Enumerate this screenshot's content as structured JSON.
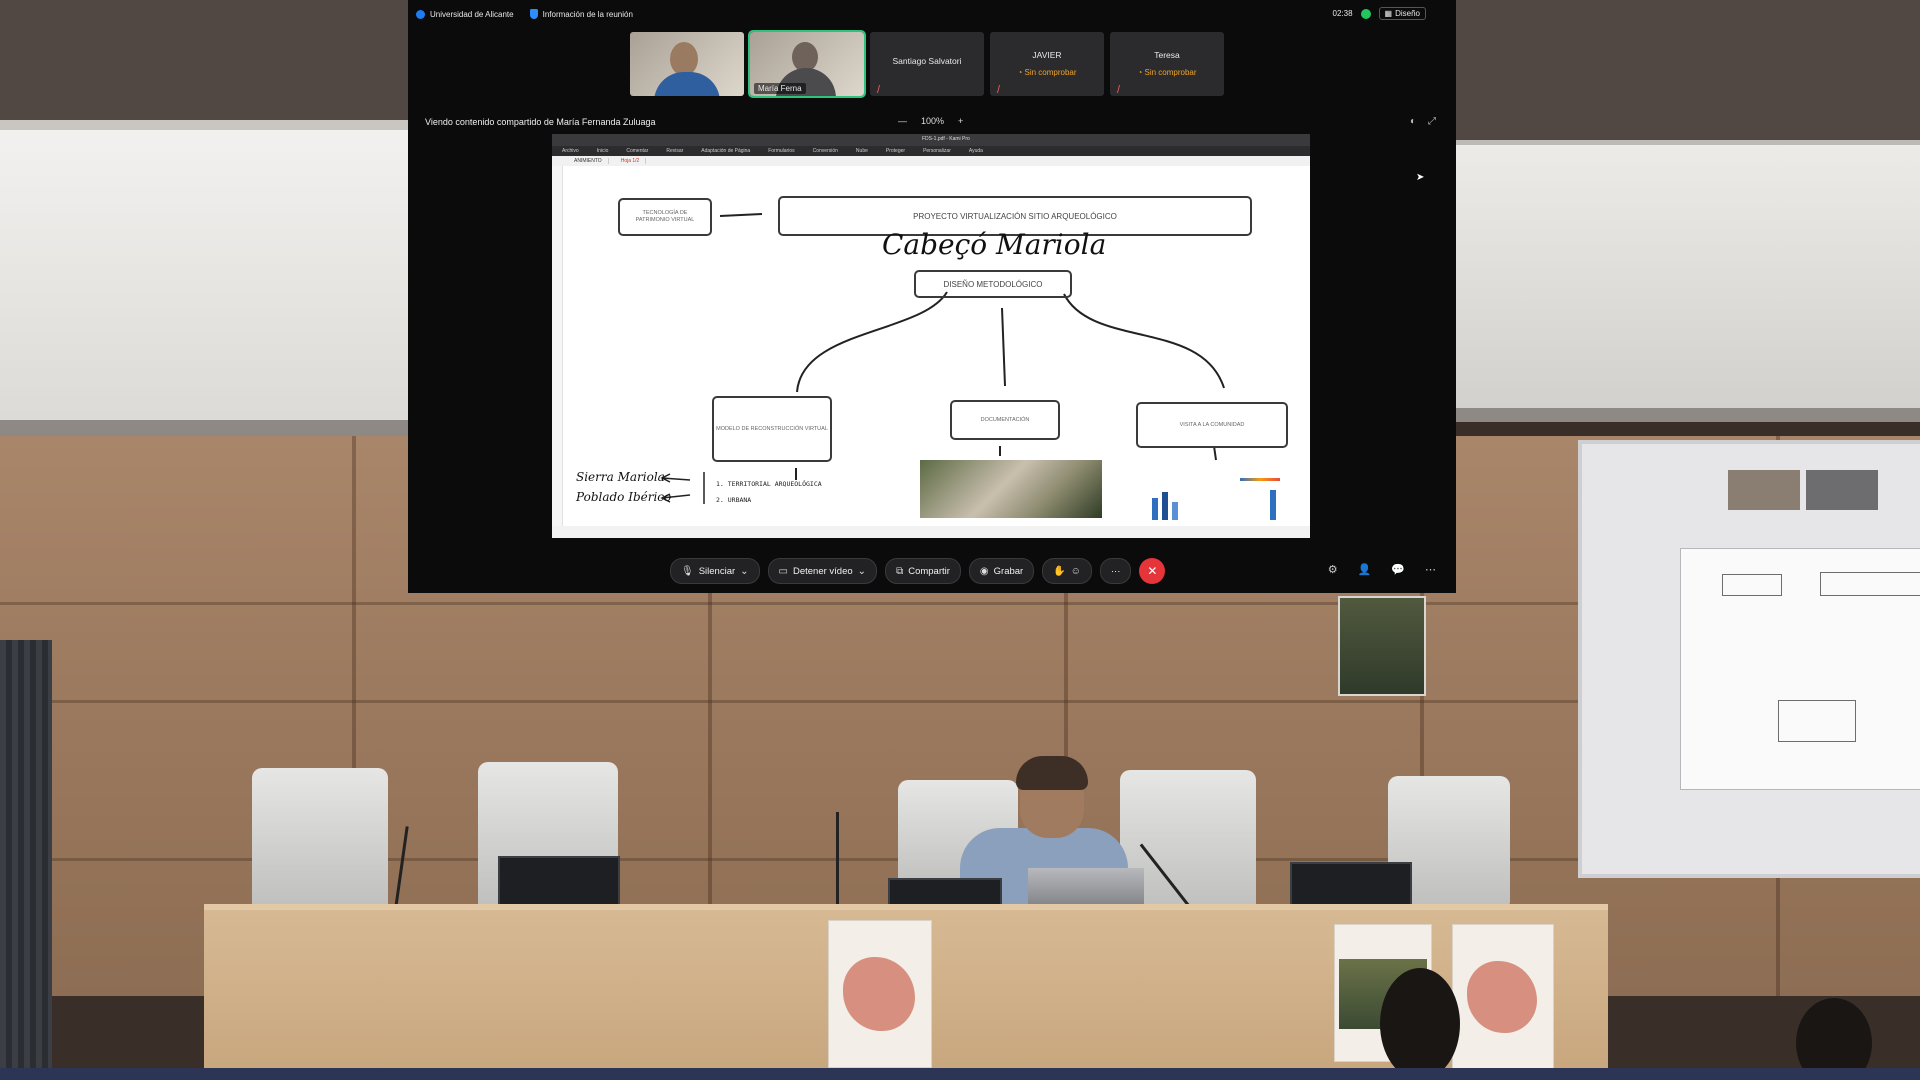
{
  "meeting": {
    "org_name": "Universidad de Alicante",
    "info_label": "Información de la reunión",
    "time": "02:38",
    "layout_label": "Diseño",
    "share_text": "Viendo contenido compartido de María Fernanda Zuluaga",
    "zoom_minus": "—",
    "zoom_level": "100%",
    "zoom_plus": "+",
    "participants": [
      {
        "name": "",
        "status": "",
        "has_video": true
      },
      {
        "name": "María Ferna",
        "status": "",
        "has_video": true,
        "active": true
      },
      {
        "name": "Santiago Salvatori",
        "status": ""
      },
      {
        "name": "JAVIER",
        "status": "Sin comprobar"
      },
      {
        "name": "Teresa",
        "status": "Sin comprobar"
      }
    ]
  },
  "shared_doc": {
    "app_title": "FDS-1.pdf - Kami Pro",
    "ribbon": [
      "Archivo",
      "Inicio",
      "Comentar",
      "Revisar",
      "Adaptación de Página",
      "Formularios",
      "Conversión",
      "Nube",
      "Proteger",
      "Personalizar",
      "Ayuda"
    ],
    "tabs": [
      "ANIMIENTO",
      "Hoja 1/2"
    ],
    "box_left": "TECNOLOGÍA DE\nPATRIMONIO VIRTUAL",
    "box_title": "PROYECTO VIRTUALIZACIÓN SITIO ARQUEOLÓGICO",
    "handwriting_title": "Cabeçó Mariola",
    "box_method": "DISEÑO METODOLÓGICO",
    "box_branch_left": "MODELO DE RECONSTRUCCIÓN VIRTUAL",
    "box_branch_mid": "DOCUMENTACIÓN",
    "box_branch_right": "VISITA A LA COMUNIDAD",
    "hand_note_1": "Sierra Mariola",
    "hand_note_2": "Poblado Ibérico",
    "note_1": "1. TERRITORIAL ARQUEOLÓGICA",
    "note_2": "2. URBANA"
  },
  "controls": {
    "mute": "Silenciar",
    "video": "Detener vídeo",
    "share": "Compartir",
    "record": "Grabar",
    "more": "···",
    "end": "✕"
  }
}
